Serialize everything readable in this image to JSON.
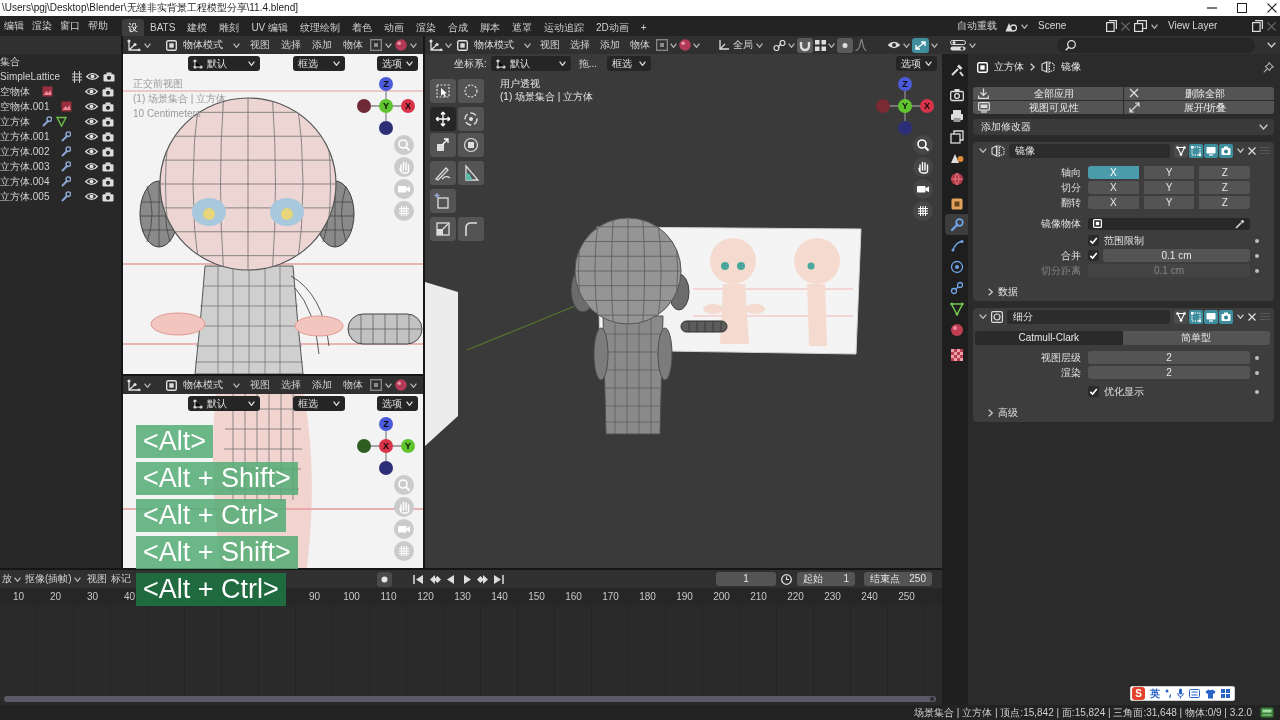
{
  "title_bar": {
    "path": "\\Users\\pgj\\Desktop\\Blender\\无缝非实背景工程模型分享\\11.4.blend]"
  },
  "top_bar": {
    "menus": [
      "编辑",
      "渲染",
      "窗口",
      "帮助"
    ],
    "workspaces": [
      {
        "label": "设",
        "selected": true
      },
      {
        "label": "BATS",
        "selected": false
      },
      {
        "label": "建模",
        "selected": false
      },
      {
        "label": "雕刻",
        "selected": false
      },
      {
        "label": "UV 编辑",
        "selected": false
      },
      {
        "label": "纹理绘制",
        "selected": false
      },
      {
        "label": "着色",
        "selected": false
      },
      {
        "label": "动画",
        "selected": false
      },
      {
        "label": "渲染",
        "selected": false
      },
      {
        "label": "合成",
        "selected": false
      },
      {
        "label": "脚本",
        "selected": false
      },
      {
        "label": "遮罩",
        "selected": false
      },
      {
        "label": "运动追踪",
        "selected": false
      },
      {
        "label": "2D动画",
        "selected": false
      }
    ],
    "add_workspace": "+",
    "auto_reload": "自动重载",
    "scene": "Scene",
    "view_layer": "View Layer"
  },
  "outliner": {
    "collection": "集合",
    "items": [
      {
        "name": "SimpleLattice",
        "kind": "lattice"
      },
      {
        "name": "空物体",
        "kind": "image_empty"
      },
      {
        "name": "空物体.001",
        "kind": "image_empty"
      },
      {
        "name": "立方体",
        "kind": "mesh_with_data"
      },
      {
        "name": "立方体.001",
        "kind": "mesh"
      },
      {
        "name": "立方体.002",
        "kind": "mesh"
      },
      {
        "name": "立方体.003",
        "kind": "mesh"
      },
      {
        "name": "立方体.004",
        "kind": "mesh"
      },
      {
        "name": "立方体.005",
        "kind": "mesh"
      }
    ]
  },
  "front_view": {
    "header": {
      "mode": "物体模式",
      "menus": [
        "视图",
        "选择",
        "添加",
        "物体"
      ]
    },
    "tool_settings": {
      "orientation": "默认",
      "select": "框选",
      "options": "选项"
    },
    "overlay_text": [
      "正交前视图",
      "(1) 场景集合 | 立方体",
      "10 Centimeters"
    ],
    "gizmo": [
      {
        "label": "Z",
        "color": "#4b5ad8"
      },
      {
        "color": "#6e2a35"
      },
      {
        "label": "Y",
        "color": "#5fc42e"
      },
      {
        "label": "X",
        "color": "#d9334a"
      },
      {
        "color": "#2c2f78"
      }
    ]
  },
  "side_view": {
    "header": {
      "mode": "物体模式",
      "menus": [
        "视图",
        "选择",
        "添加",
        "物体"
      ]
    },
    "tool_settings": {
      "orientation": "默认",
      "select": "框选",
      "options": "选项"
    },
    "gizmo": [
      {
        "label": "Z",
        "color": "#4b5ad8"
      },
      {
        "color": "#2f5e22"
      },
      {
        "label": "X",
        "color": "#d9334a"
      },
      {
        "label": "Y",
        "color": "#5fc42e"
      },
      {
        "color": "#2c2f78"
      }
    ]
  },
  "main_view": {
    "header": {
      "mode": "物体模式",
      "menus": [
        "视图",
        "选择",
        "添加",
        "物体"
      ],
      "transform_orientation": "全局",
      "snap": {
        "on": true
      },
      "proportional": {
        "on": true
      },
      "gizmos": {
        "on": true
      }
    },
    "tool_settings": {
      "label": "坐标系:",
      "orientation": "默认",
      "drag": "拖...",
      "select": "框选",
      "options": "选项"
    },
    "toolbar": [
      {
        "kind": "select_box",
        "selected": false
      },
      {
        "kind": "select_circle",
        "selected": false
      },
      {
        "kind": "move",
        "selected": true
      },
      {
        "kind": "rotate",
        "selected": false
      },
      {
        "kind": "scale",
        "selected": false
      },
      {
        "kind": "transform",
        "selected": false
      },
      {
        "kind": "annotate",
        "selected": false
      },
      {
        "kind": "measure",
        "selected": false
      },
      {
        "kind": "add_cube",
        "selected": false
      },
      {
        "kind": "shear",
        "selected": false
      },
      {
        "kind": "bend",
        "selected": false
      }
    ],
    "view_name": "用户透视",
    "collection": "(1) 场景集合 | 立方体",
    "gizmo": [
      {
        "label": "Z",
        "color": "#4b5ad8"
      },
      {
        "color": "#7a2b36"
      },
      {
        "label": "Y",
        "color": "#5fc42e"
      },
      {
        "label": "X",
        "color": "#d9334a"
      },
      {
        "color": "#2c2f78"
      }
    ]
  },
  "key_overlay": [
    {
      "keys": "<Alt>",
      "active": false
    },
    {
      "keys": "<Alt + Shift>",
      "active": false
    },
    {
      "keys": "<Alt + Ctrl>",
      "active": false
    },
    {
      "keys": "<Alt + Shift>",
      "active": false
    },
    {
      "keys": "<Alt + Ctrl>",
      "active": true
    }
  ],
  "properties": {
    "tabs": [
      {
        "kind": "tool",
        "selected": false
      },
      {
        "kind": "render",
        "selected": false
      },
      {
        "kind": "output",
        "selected": false
      },
      {
        "kind": "view_layer",
        "selected": false
      },
      {
        "kind": "scene",
        "selected": false
      },
      {
        "kind": "world",
        "selected": false
      },
      {
        "kind": "object",
        "selected": false
      },
      {
        "kind": "modifiers",
        "selected": true
      },
      {
        "kind": "particles",
        "selected": false
      },
      {
        "kind": "physics",
        "selected": false
      },
      {
        "kind": "constraints",
        "selected": false
      },
      {
        "kind": "data",
        "selected": false
      },
      {
        "kind": "material",
        "selected": false
      },
      {
        "kind": "texture",
        "selected": false
      }
    ],
    "breadcrumb": {
      "object": "立方体",
      "modifier": "镜像"
    },
    "actions": [
      {
        "kind": "apply",
        "label": "全部应用"
      },
      {
        "kind": "delete",
        "label": "删除全部"
      },
      {
        "kind": "visibility",
        "label": "视图可见性"
      },
      {
        "kind": "expand",
        "label": "展开/折叠"
      }
    ],
    "add_modifier": "添加修改器",
    "mirror": {
      "name": "镜像",
      "expanded": true,
      "toggles": [
        {
          "kind": "on_cage",
          "on": false
        },
        {
          "kind": "edit_mode",
          "on": true
        },
        {
          "kind": "viewport",
          "on": true
        },
        {
          "kind": "render",
          "on": true
        }
      ],
      "axis_rows": [
        {
          "label": "轴向",
          "axes": [
            {
              "label": "X",
              "selected": true
            },
            {
              "label": "Y",
              "selected": false
            },
            {
              "label": "Z",
              "selected": false
            }
          ]
        },
        {
          "label": "切分",
          "axes": [
            {
              "label": "X",
              "selected": false
            },
            {
              "label": "Y",
              "selected": false
            },
            {
              "label": "Z",
              "selected": false
            }
          ]
        },
        {
          "label": "翻转",
          "axes": [
            {
              "label": "X",
              "selected": false
            },
            {
              "label": "Y",
              "selected": false
            },
            {
              "label": "Z",
              "selected": false
            }
          ]
        }
      ],
      "mirror_object": {
        "label": "镜像物体"
      },
      "clipping": {
        "label": "范围限制",
        "checked": true
      },
      "merge": {
        "label": "合并",
        "checked": true,
        "value": "0.1 cm"
      },
      "bisect_distance": {
        "label": "切分距离",
        "value": "0.1 cm",
        "disabled": true
      },
      "data": {
        "label": "数据",
        "expanded": false
      }
    },
    "subdivision": {
      "name": "细分",
      "expanded": true,
      "toggles": [
        {
          "kind": "on_cage",
          "on": false
        },
        {
          "kind": "edit_mode",
          "on": true
        },
        {
          "kind": "viewport",
          "on": true
        },
        {
          "kind": "render",
          "on": true
        }
      ],
      "types": [
        {
          "label": "Catmull-Clark",
          "selected": true
        },
        {
          "label": "简单型",
          "selected": false
        }
      ],
      "levels": [
        {
          "label": "视图层级",
          "value": "2"
        },
        {
          "label": "渲染",
          "value": "2"
        }
      ],
      "optimal_display": {
        "label": "优化显示",
        "checked": true
      },
      "advanced": {
        "label": "高级",
        "expanded": false
      }
    }
  },
  "timeline": {
    "menus": [
      {
        "label": "放",
        "kind": "dropdown"
      },
      {
        "label": "抠像(插帧)",
        "kind": "dropdown"
      },
      {
        "label": "视图",
        "kind": "menu"
      },
      {
        "label": "标记",
        "kind": "menu"
      }
    ],
    "current_frame": "1",
    "start": {
      "label": "起始",
      "value": "1"
    },
    "end": {
      "label": "结束点",
      "value": "250"
    },
    "ticks_before": [
      "10",
      "20",
      "30",
      "40"
    ],
    "ticks_after": [
      "90",
      "100",
      "110",
      "120",
      "130",
      "140",
      "150",
      "160",
      "170",
      "180",
      "190",
      "200",
      "210",
      "220",
      "230",
      "240",
      "250"
    ]
  },
  "status_bar": {
    "stats": "场景集合 | 立方体 | 顶点:15,842 | 面:15,824 | 三角面:31,648 | 物体:0/9 | 3.2.0"
  },
  "ime_toolbar": {
    "logo": "S",
    "mode": "英"
  }
}
